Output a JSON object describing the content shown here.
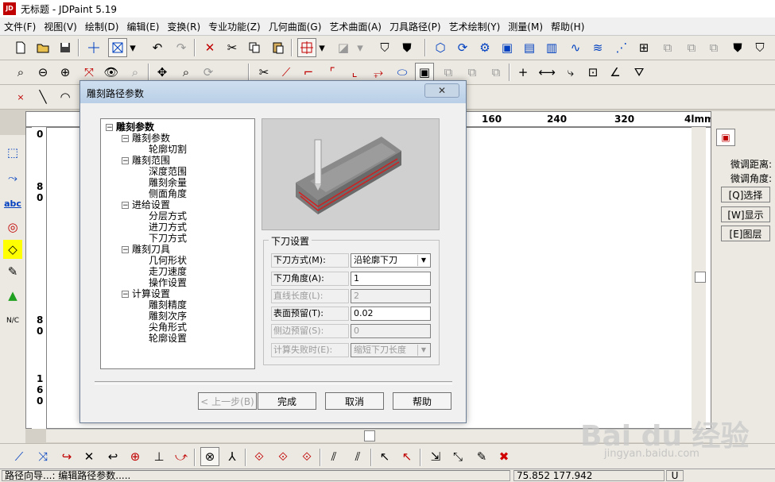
{
  "window": {
    "title": "无标题 - JDPaint 5.19",
    "app_icon": "JD"
  },
  "menu": [
    "文件(F)",
    "视图(V)",
    "绘制(D)",
    "编辑(E)",
    "变换(R)",
    "专业功能(Z)",
    "几何曲面(G)",
    "艺术曲面(A)",
    "刀具路径(P)",
    "艺术绘制(Y)",
    "测量(M)",
    "帮助(H)"
  ],
  "ruler": {
    "top_marks": [
      "160",
      "240",
      "320",
      "4lmm"
    ],
    "left_marks": [
      "0",
      "8",
      "0",
      "8",
      "0",
      "1",
      "6",
      "0"
    ]
  },
  "right_panel": {
    "label_fine_distance": "微调距离:",
    "label_fine_angle": "微调角度:",
    "btn_select": "[Q]选择",
    "btn_display": "[W]显示",
    "btn_layer": "[E]图层"
  },
  "dialog": {
    "title": "雕刻路径参数",
    "close": "✕",
    "tree": [
      {
        "label": "雕刻参数",
        "level": 0,
        "bold": true,
        "expander": "−"
      },
      {
        "label": "雕刻参数",
        "level": 1,
        "expander": "−"
      },
      {
        "label": "轮廓切割",
        "level": 2
      },
      {
        "label": "雕刻范围",
        "level": 1,
        "expander": "−"
      },
      {
        "label": "深度范围",
        "level": 2
      },
      {
        "label": "雕刻余量",
        "level": 2
      },
      {
        "label": "侧面角度",
        "level": 2
      },
      {
        "label": "进给设置",
        "level": 1,
        "expander": "−"
      },
      {
        "label": "分层方式",
        "level": 2
      },
      {
        "label": "进刀方式",
        "level": 2
      },
      {
        "label": "下刀方式",
        "level": 2
      },
      {
        "label": "雕刻刀具",
        "level": 1,
        "expander": "−"
      },
      {
        "label": "几何形状",
        "level": 2
      },
      {
        "label": "走刀速度",
        "level": 2
      },
      {
        "label": "操作设置",
        "level": 2
      },
      {
        "label": "计算设置",
        "level": 1,
        "expander": "−"
      },
      {
        "label": "雕刻精度",
        "level": 2
      },
      {
        "label": "雕刻次序",
        "level": 2
      },
      {
        "label": "尖角形式",
        "level": 2
      },
      {
        "label": "轮廓设置",
        "level": 2
      }
    ],
    "group_title": "下刀设置",
    "fields": [
      {
        "label": "下刀方式(M):",
        "value": "沿轮廓下刀",
        "type": "dropdown",
        "enabled": true
      },
      {
        "label": "下刀角度(A):",
        "value": "1",
        "type": "text",
        "enabled": true
      },
      {
        "label": "直线长度(L):",
        "value": "2",
        "type": "text",
        "enabled": false
      },
      {
        "label": "表面预留(T):",
        "value": "0.02",
        "type": "text",
        "enabled": true
      },
      {
        "label": "侧边预留(S):",
        "value": "0",
        "type": "text",
        "enabled": false
      },
      {
        "label": "计算失败时(E):",
        "value": "缩短下刀长度",
        "type": "dropdown",
        "enabled": false
      }
    ],
    "buttons": {
      "prev": "< 上一步(B)",
      "finish": "完成",
      "cancel": "取消",
      "help": "帮助"
    }
  },
  "status": {
    "message": "路径向导...: 编辑路径参数.....",
    "coords": "75.852  177.942",
    "mode": "U"
  },
  "watermark": {
    "text": "Bai du 经验",
    "url": "jingyan.baidu.com"
  },
  "colors": {
    "dialog_title": "#b9cfe6",
    "accent_red": "#cc0000",
    "canvas": "#ffffff"
  }
}
